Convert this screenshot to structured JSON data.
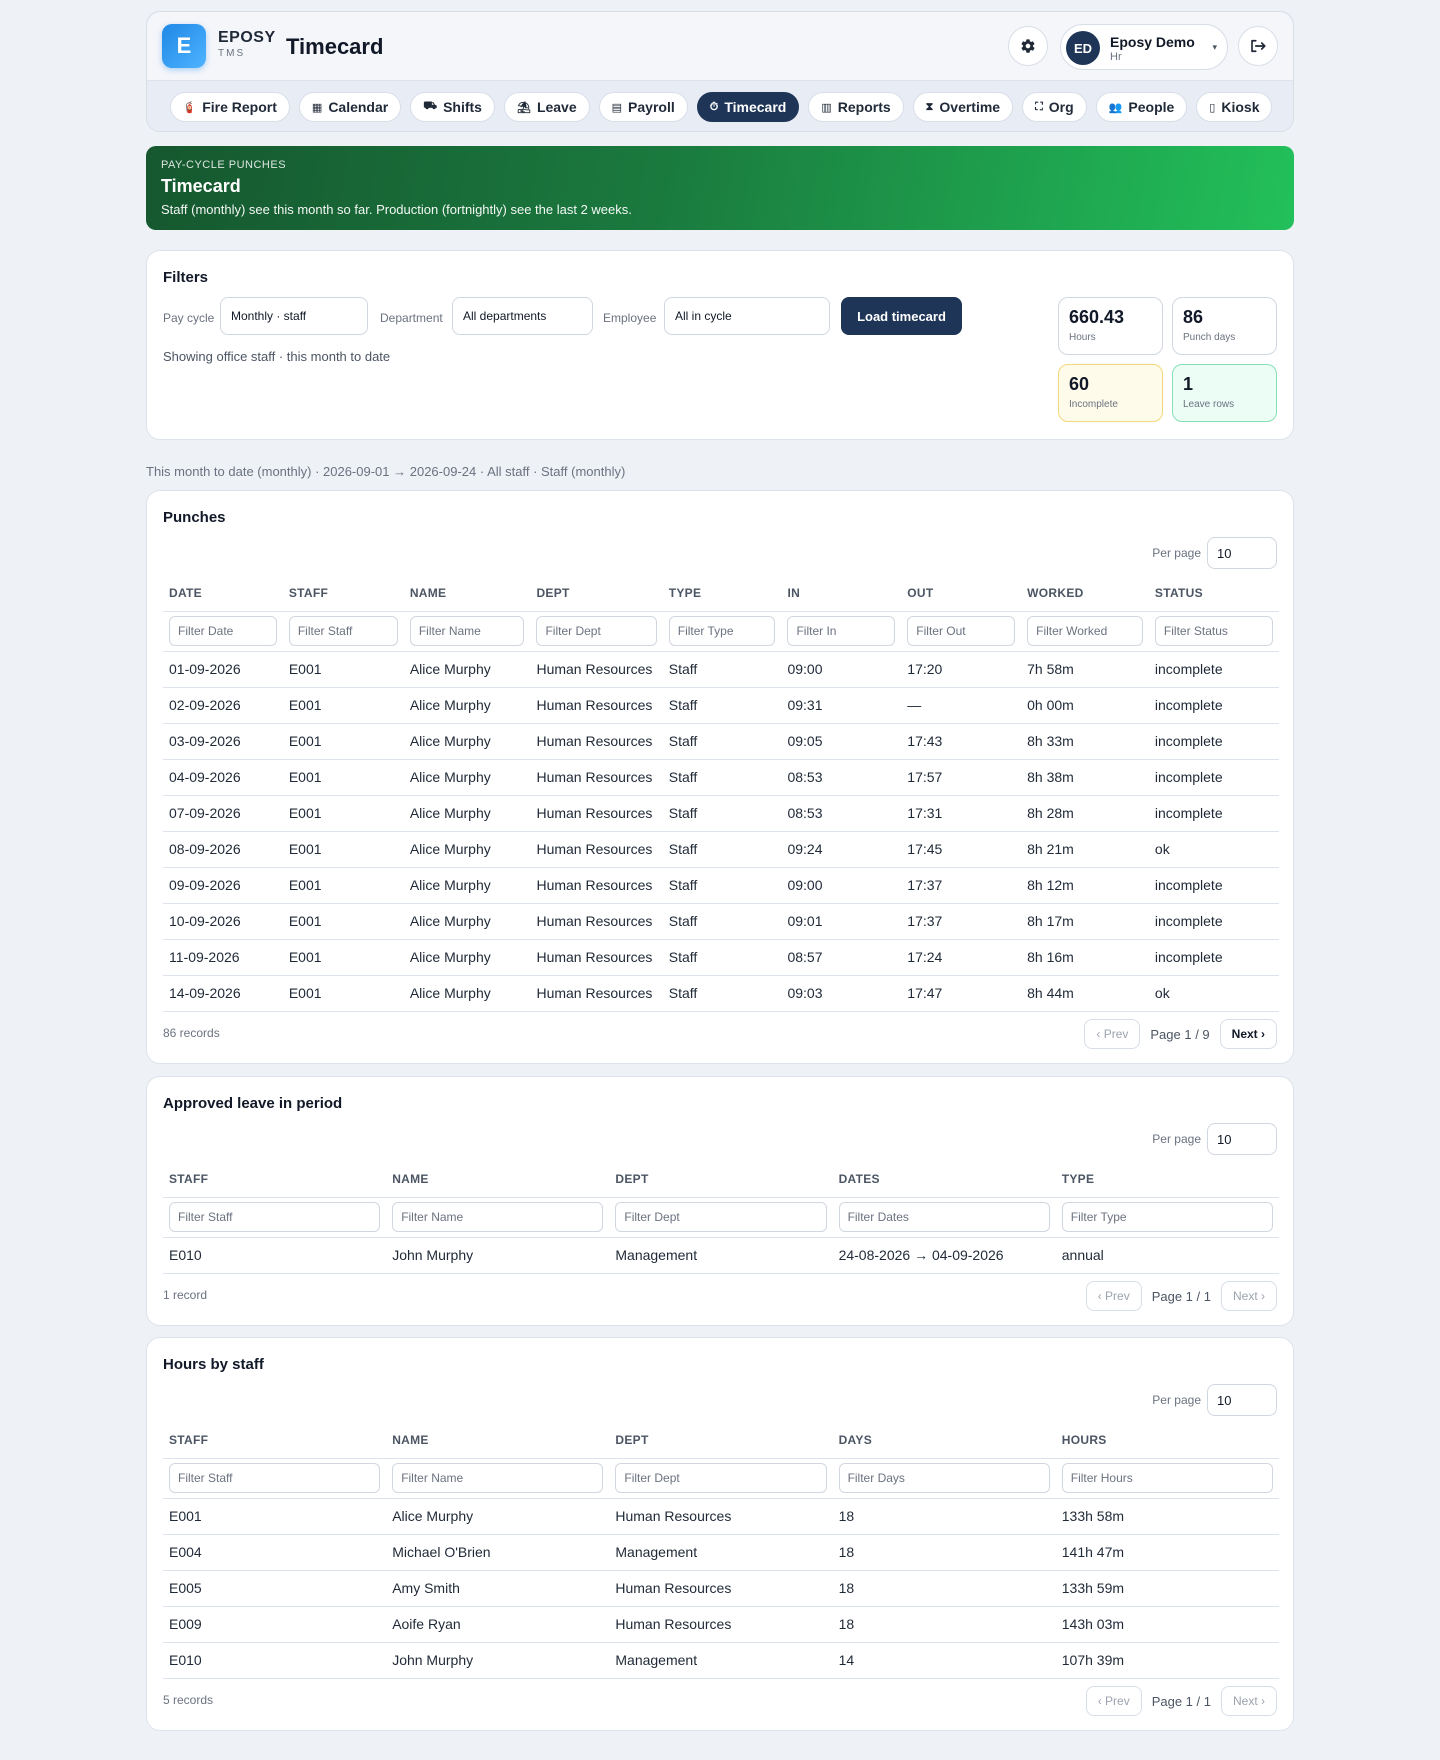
{
  "brand": {
    "logo_letter": "E",
    "name": "EPOSY",
    "sub": "TMS"
  },
  "app_title": "Timecard",
  "user": {
    "initials": "ED",
    "name": "Eposy Demo",
    "role": "Hr"
  },
  "nav": [
    {
      "label": "Fire Report",
      "icon": "fire-extinguisher-icon"
    },
    {
      "label": "Calendar",
      "icon": "calendar-icon"
    },
    {
      "label": "Shifts",
      "icon": "truck-icon"
    },
    {
      "label": "Leave",
      "icon": "umbrella-beach-icon"
    },
    {
      "label": "Payroll",
      "icon": "document-icon"
    },
    {
      "label": "Timecard",
      "icon": "stopwatch-icon",
      "active": true
    },
    {
      "label": "Reports",
      "icon": "bar-chart-icon"
    },
    {
      "label": "Overtime",
      "icon": "hourglass-icon"
    },
    {
      "label": "Org",
      "icon": "org-chart-icon"
    },
    {
      "label": "People",
      "icon": "people-icon"
    },
    {
      "label": "Kiosk",
      "icon": "tablet-icon"
    }
  ],
  "banner": {
    "kicker": "PAY-CYCLE PUNCHES",
    "title": "Timecard",
    "desc": "Staff (monthly) see this month so far. Production (fortnightly) see the last 2 weeks."
  },
  "filters": {
    "title": "Filters",
    "pay_cycle_label": "Pay cycle",
    "pay_cycle_value": "Monthly · staff",
    "department_label": "Department",
    "department_value": "All departments",
    "employee_label": "Employee",
    "employee_value": "All in cycle",
    "load_button": "Load timecard",
    "note": "Showing office staff · this month to date"
  },
  "stats": {
    "hours": {
      "value": "660.43",
      "label": "Hours"
    },
    "punch_days": {
      "value": "86",
      "label": "Punch days"
    },
    "incomplete": {
      "value": "60",
      "label": "Incomplete"
    },
    "leave_rows": {
      "value": "1",
      "label": "Leave rows"
    }
  },
  "range_line": "This month to date (monthly) · 2026-09-01 → 2026-09-24 · All staff · Staff (monthly)",
  "punches": {
    "title": "Punches",
    "per_page_label": "Per page",
    "per_page": "10",
    "columns": [
      "DATE",
      "STAFF",
      "NAME",
      "DEPT",
      "TYPE",
      "IN",
      "OUT",
      "WORKED",
      "STATUS"
    ],
    "filters": [
      "Filter Date",
      "Filter Staff",
      "Filter Name",
      "Filter Dept",
      "Filter Type",
      "Filter In",
      "Filter Out",
      "Filter Worked",
      "Filter Status"
    ],
    "rows": [
      [
        "01-09-2026",
        "E001",
        "Alice Murphy",
        "Human Resources",
        "Staff",
        "09:00",
        "17:20",
        "7h 58m",
        "incomplete"
      ],
      [
        "02-09-2026",
        "E001",
        "Alice Murphy",
        "Human Resources",
        "Staff",
        "09:31",
        "—",
        "0h 00m",
        "incomplete"
      ],
      [
        "03-09-2026",
        "E001",
        "Alice Murphy",
        "Human Resources",
        "Staff",
        "09:05",
        "17:43",
        "8h 33m",
        "incomplete"
      ],
      [
        "04-09-2026",
        "E001",
        "Alice Murphy",
        "Human Resources",
        "Staff",
        "08:53",
        "17:57",
        "8h 38m",
        "incomplete"
      ],
      [
        "07-09-2026",
        "E001",
        "Alice Murphy",
        "Human Resources",
        "Staff",
        "08:53",
        "17:31",
        "8h 28m",
        "incomplete"
      ],
      [
        "08-09-2026",
        "E001",
        "Alice Murphy",
        "Human Resources",
        "Staff",
        "09:24",
        "17:45",
        "8h 21m",
        "ok"
      ],
      [
        "09-09-2026",
        "E001",
        "Alice Murphy",
        "Human Resources",
        "Staff",
        "09:00",
        "17:37",
        "8h 12m",
        "incomplete"
      ],
      [
        "10-09-2026",
        "E001",
        "Alice Murphy",
        "Human Resources",
        "Staff",
        "09:01",
        "17:37",
        "8h 17m",
        "incomplete"
      ],
      [
        "11-09-2026",
        "E001",
        "Alice Murphy",
        "Human Resources",
        "Staff",
        "08:57",
        "17:24",
        "8h 16m",
        "incomplete"
      ],
      [
        "14-09-2026",
        "E001",
        "Alice Murphy",
        "Human Resources",
        "Staff",
        "09:03",
        "17:47",
        "8h 44m",
        "ok"
      ]
    ],
    "count": "86 records",
    "prev": "‹ Prev",
    "page_info": "Page 1 / 9",
    "next": "Next ›"
  },
  "leave": {
    "title": "Approved leave in period",
    "per_page_label": "Per page",
    "per_page": "10",
    "columns": [
      "STAFF",
      "NAME",
      "DEPT",
      "DATES",
      "TYPE"
    ],
    "filters": [
      "Filter Staff",
      "Filter Name",
      "Filter Dept",
      "Filter Dates",
      "Filter Type"
    ],
    "rows": [
      [
        "E010",
        "John Murphy",
        "Management",
        "24-08-2026 → 04-09-2026",
        "annual"
      ]
    ],
    "count": "1 record",
    "prev": "‹ Prev",
    "page_info": "Page 1 / 1",
    "next": "Next ›"
  },
  "hours": {
    "title": "Hours by staff",
    "per_page_label": "Per page",
    "per_page": "10",
    "columns": [
      "STAFF",
      "NAME",
      "DEPT",
      "DAYS",
      "HOURS"
    ],
    "filters": [
      "Filter Staff",
      "Filter Name",
      "Filter Dept",
      "Filter Days",
      "Filter Hours"
    ],
    "rows": [
      [
        "E001",
        "Alice Murphy",
        "Human Resources",
        "18",
        "133h 58m"
      ],
      [
        "E004",
        "Michael O'Brien",
        "Management",
        "18",
        "141h 47m"
      ],
      [
        "E005",
        "Amy Smith",
        "Human Resources",
        "18",
        "133h 59m"
      ],
      [
        "E009",
        "Aoife Ryan",
        "Human Resources",
        "18",
        "143h 03m"
      ],
      [
        "E010",
        "John Murphy",
        "Management",
        "14",
        "107h 39m"
      ]
    ],
    "count": "5 records",
    "prev": "‹ Prev",
    "page_info": "Page 1 / 1",
    "next": "Next ›"
  }
}
